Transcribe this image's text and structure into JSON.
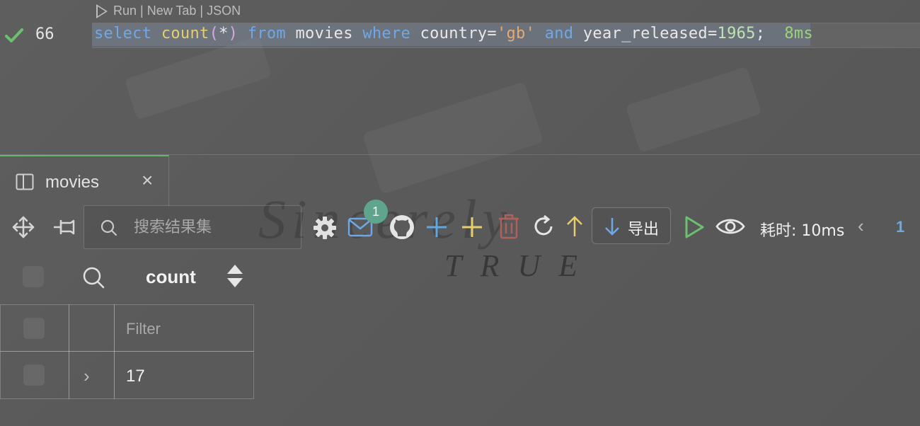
{
  "editor": {
    "codelens": "Run | New Tab | JSON",
    "line_number": "66",
    "sql_tokens": {
      "select": "select",
      "count": "count",
      "open": "(",
      "star": "*",
      "close": ")",
      "from": "from",
      "table": "movies",
      "where": "where",
      "col1": "country=",
      "val1": "'gb'",
      "and": "and",
      "col2": "year_released=",
      "val2": "1965",
      "semi": ";"
    },
    "timing": "8ms"
  },
  "tab": {
    "label": "movies"
  },
  "toolbar": {
    "search_placeholder": "搜索结果集",
    "badge_count": "1",
    "export_label": "导出",
    "elapsed": "耗时: 10ms",
    "page": "1"
  },
  "grid": {
    "column": "count",
    "filter_placeholder": "Filter",
    "rows": [
      {
        "count": "17"
      }
    ]
  },
  "background": {
    "watermark_main": "Sincerely",
    "watermark_sub": "TRUE"
  },
  "colors": {
    "accent_blue": "#6ea8e6",
    "accent_green": "#6ab36a",
    "badge": "#5fa58e",
    "yellow": "#e6cf6a",
    "delete_red": "#b0605a"
  }
}
